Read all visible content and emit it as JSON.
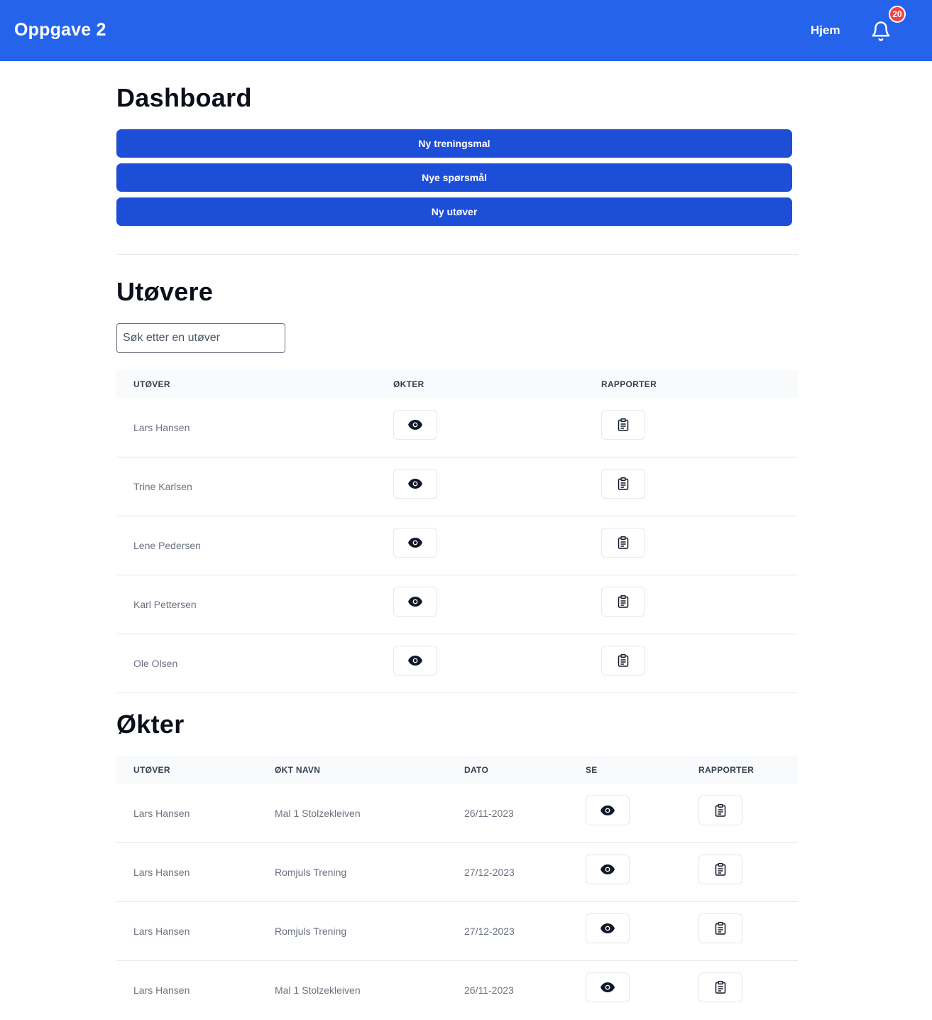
{
  "navbar": {
    "brand": "Oppgave 2",
    "home_link": "Hjem",
    "notification_count": "20",
    "color": "#2563eb"
  },
  "dashboard": {
    "title": "Dashboard",
    "buttons": [
      "Ny treningsmal",
      "Nye spørsmål",
      "Ny utøver"
    ],
    "button_color": "#1d4ed8"
  },
  "athletes": {
    "title": "Utøvere",
    "search_placeholder": "Søk etter en utøver",
    "headers": [
      "UTØVER",
      "ØKTER",
      "RAPPORTER"
    ],
    "rows": [
      {
        "name": "Lars Hansen"
      },
      {
        "name": "Trine Karlsen"
      },
      {
        "name": "Lene Pedersen"
      },
      {
        "name": "Karl Pettersen"
      },
      {
        "name": "Ole Olsen"
      }
    ]
  },
  "sessions": {
    "title": "Økter",
    "headers": [
      "UTØVER",
      "ØKT NAVN",
      "DATO",
      "SE",
      "RAPPORTER"
    ],
    "rows": [
      {
        "athlete": "Lars Hansen",
        "session": "Mal 1 Stolzekleiven",
        "date": "26/11-2023"
      },
      {
        "athlete": "Lars Hansen",
        "session": "Romjuls Trening",
        "date": "27/12-2023"
      },
      {
        "athlete": "Lars Hansen",
        "session": "Romjuls Trening",
        "date": "27/12-2023"
      },
      {
        "athlete": "Lars Hansen",
        "session": "Mal 1 Stolzekleiven",
        "date": "26/11-2023"
      }
    ]
  },
  "icons": {
    "view": "eye-icon",
    "report": "clipboard-icon",
    "notifications": "bell-icon"
  }
}
